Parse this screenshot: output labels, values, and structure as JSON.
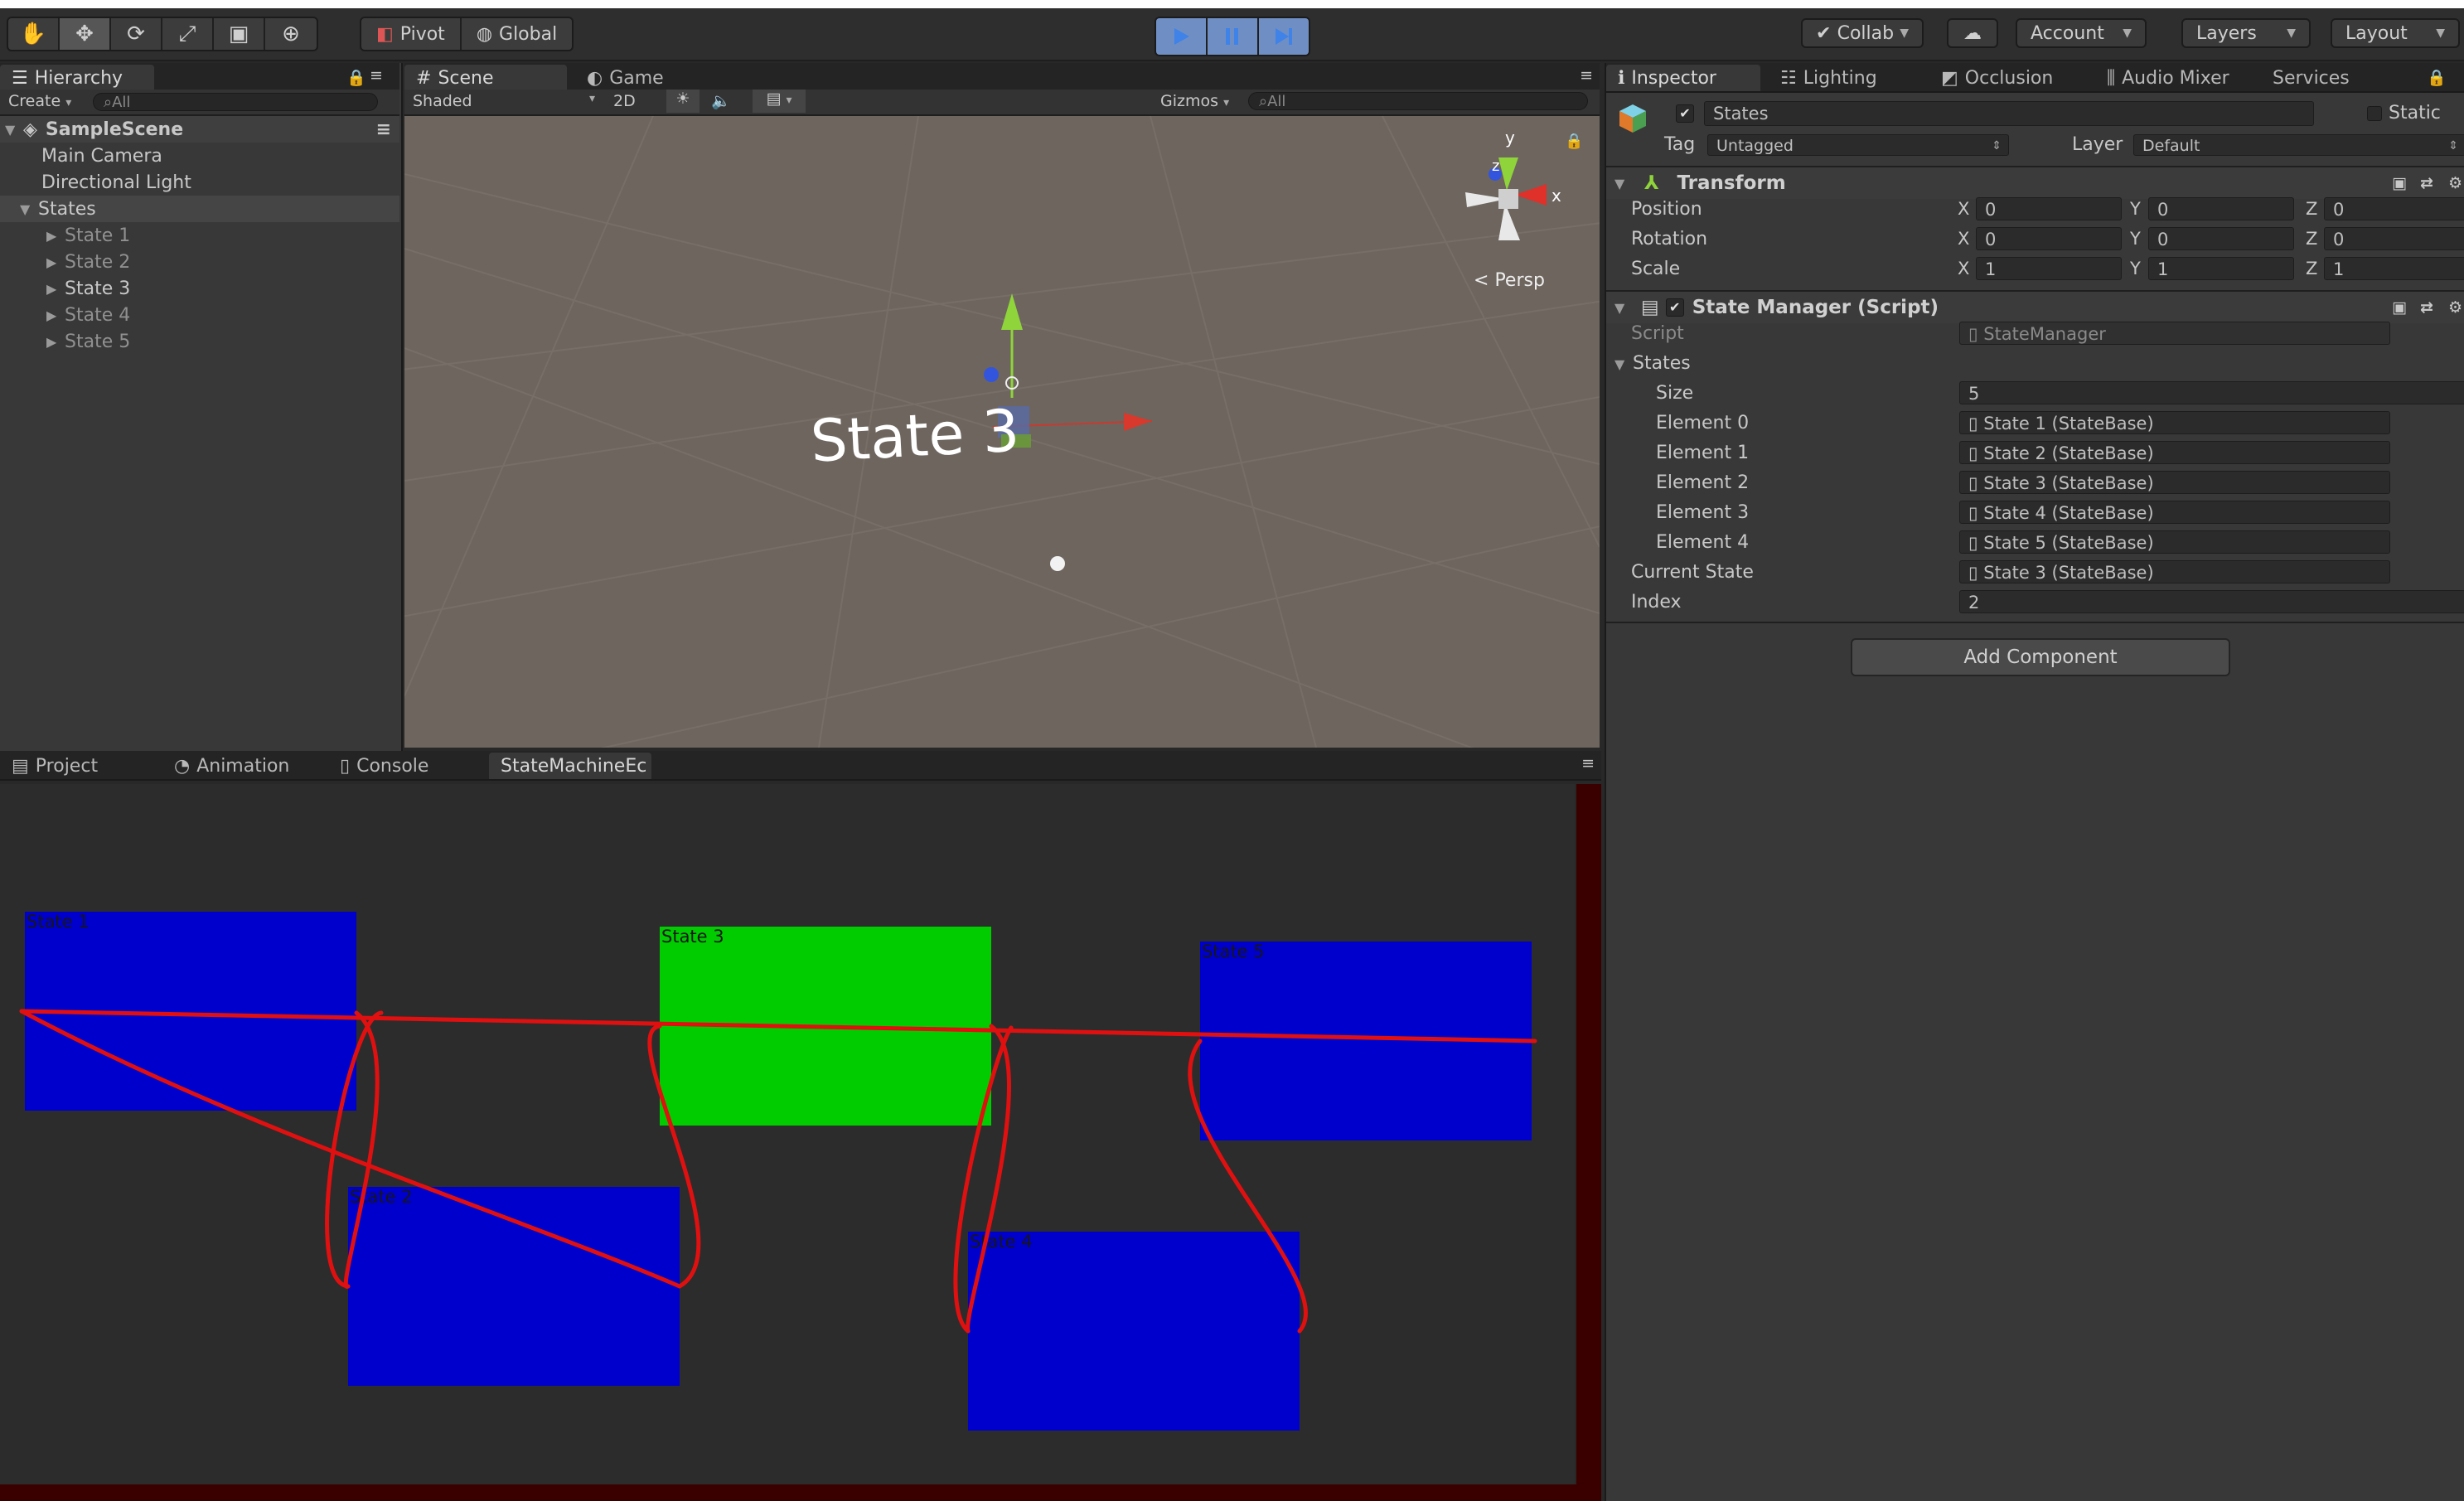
{
  "toolbar": {
    "pivot": "Pivot",
    "global": "Global",
    "collab": "Collab",
    "account": "Account",
    "layers": "Layers",
    "layout": "Layout"
  },
  "hierarchy": {
    "tab": "Hierarchy",
    "create": "Create",
    "search_placeholder": "All",
    "scene_name": "SampleScene",
    "items": [
      {
        "label": "Main Camera"
      },
      {
        "label": "Directional Light"
      },
      {
        "label": "States"
      },
      {
        "label": "State 1"
      },
      {
        "label": "State 2"
      },
      {
        "label": "State 3"
      },
      {
        "label": "State 4"
      },
      {
        "label": "State 5"
      }
    ]
  },
  "scene": {
    "tab_scene": "Scene",
    "tab_game": "Game",
    "shading": "Shaded",
    "mode_2d": "2D",
    "gizmos": "Gizmos",
    "search_placeholder": "All",
    "persp": "Persp",
    "label_3d": "State 3",
    "axis_y": "y",
    "axis_z": "z",
    "axis_x": "x"
  },
  "inspector": {
    "tabs": [
      "Inspector",
      "Lighting",
      "Occlusion",
      "Audio Mixer",
      "Services"
    ],
    "object_name": "States",
    "static_label": "Static",
    "tag_label": "Tag",
    "tag_value": "Untagged",
    "layer_label": "Layer",
    "layer_value": "Default",
    "transform": {
      "title": "Transform",
      "position_label": "Position",
      "rotation_label": "Rotation",
      "scale_label": "Scale",
      "position": [
        "0",
        "0",
        "0"
      ],
      "rotation": [
        "0",
        "0",
        "0"
      ],
      "scale": [
        "1",
        "1",
        "1"
      ],
      "axis_x": "X",
      "axis_y": "Y",
      "axis_z": "Z"
    },
    "state_manager": {
      "title": "State Manager (Script)",
      "script_label": "Script",
      "script_value": "StateManager",
      "states_label": "States",
      "size_label": "Size",
      "size_value": "5",
      "elements": [
        {
          "label": "Element 0",
          "value": "State 1 (StateBase)"
        },
        {
          "label": "Element 1",
          "value": "State 2 (StateBase)"
        },
        {
          "label": "Element 2",
          "value": "State 3 (StateBase)"
        },
        {
          "label": "Element 3",
          "value": "State 4 (StateBase)"
        },
        {
          "label": "Element 4",
          "value": "State 5 (StateBase)"
        }
      ],
      "current_state_label": "Current State",
      "current_state_value": "State 3 (StateBase)",
      "index_label": "Index",
      "index_value": "2"
    },
    "add_component": "Add Component"
  },
  "bottom": {
    "tabs": [
      "Project",
      "Animation",
      "Console",
      "StateMachineEc"
    ],
    "states": [
      {
        "label": "State 1",
        "active": false
      },
      {
        "label": "State 2",
        "active": false
      },
      {
        "label": "State 3",
        "active": true
      },
      {
        "label": "State 4",
        "active": false
      },
      {
        "label": "State 5",
        "active": false
      }
    ]
  },
  "colors": {
    "state_inactive": "#0000cc",
    "state_active": "#00cc00",
    "transition": "#e01010",
    "play_accent": "#6f8fc4"
  }
}
